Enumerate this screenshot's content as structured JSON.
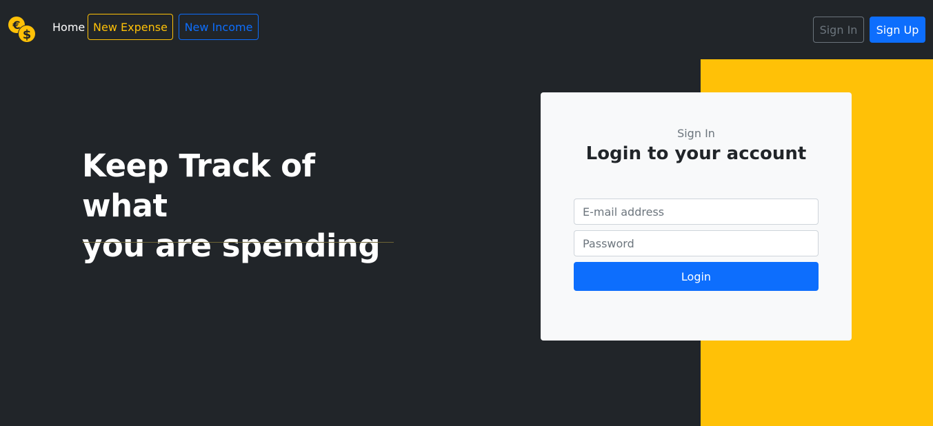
{
  "nav": {
    "logo_icon": "coins-euro-dollar-icon",
    "home_label": "Home",
    "new_expense_label": "New Expense",
    "new_income_label": "New Income",
    "sign_in_label": "Sign In",
    "sign_up_label": "Sign Up"
  },
  "hero": {
    "title_line1": "Keep Track of what",
    "title_line2": "you are spending"
  },
  "login": {
    "kicker": "Sign In",
    "title": "Login to your account",
    "email_placeholder": "E-mail address",
    "email_value": "",
    "password_placeholder": "Password",
    "password_value": "",
    "submit_label": "Login"
  },
  "colors": {
    "background": "#212529",
    "accent_yellow": "#ffc107",
    "primary_blue": "#0d6efd",
    "secondary_gray": "#6c757d",
    "card_bg": "#f8f9fa"
  }
}
